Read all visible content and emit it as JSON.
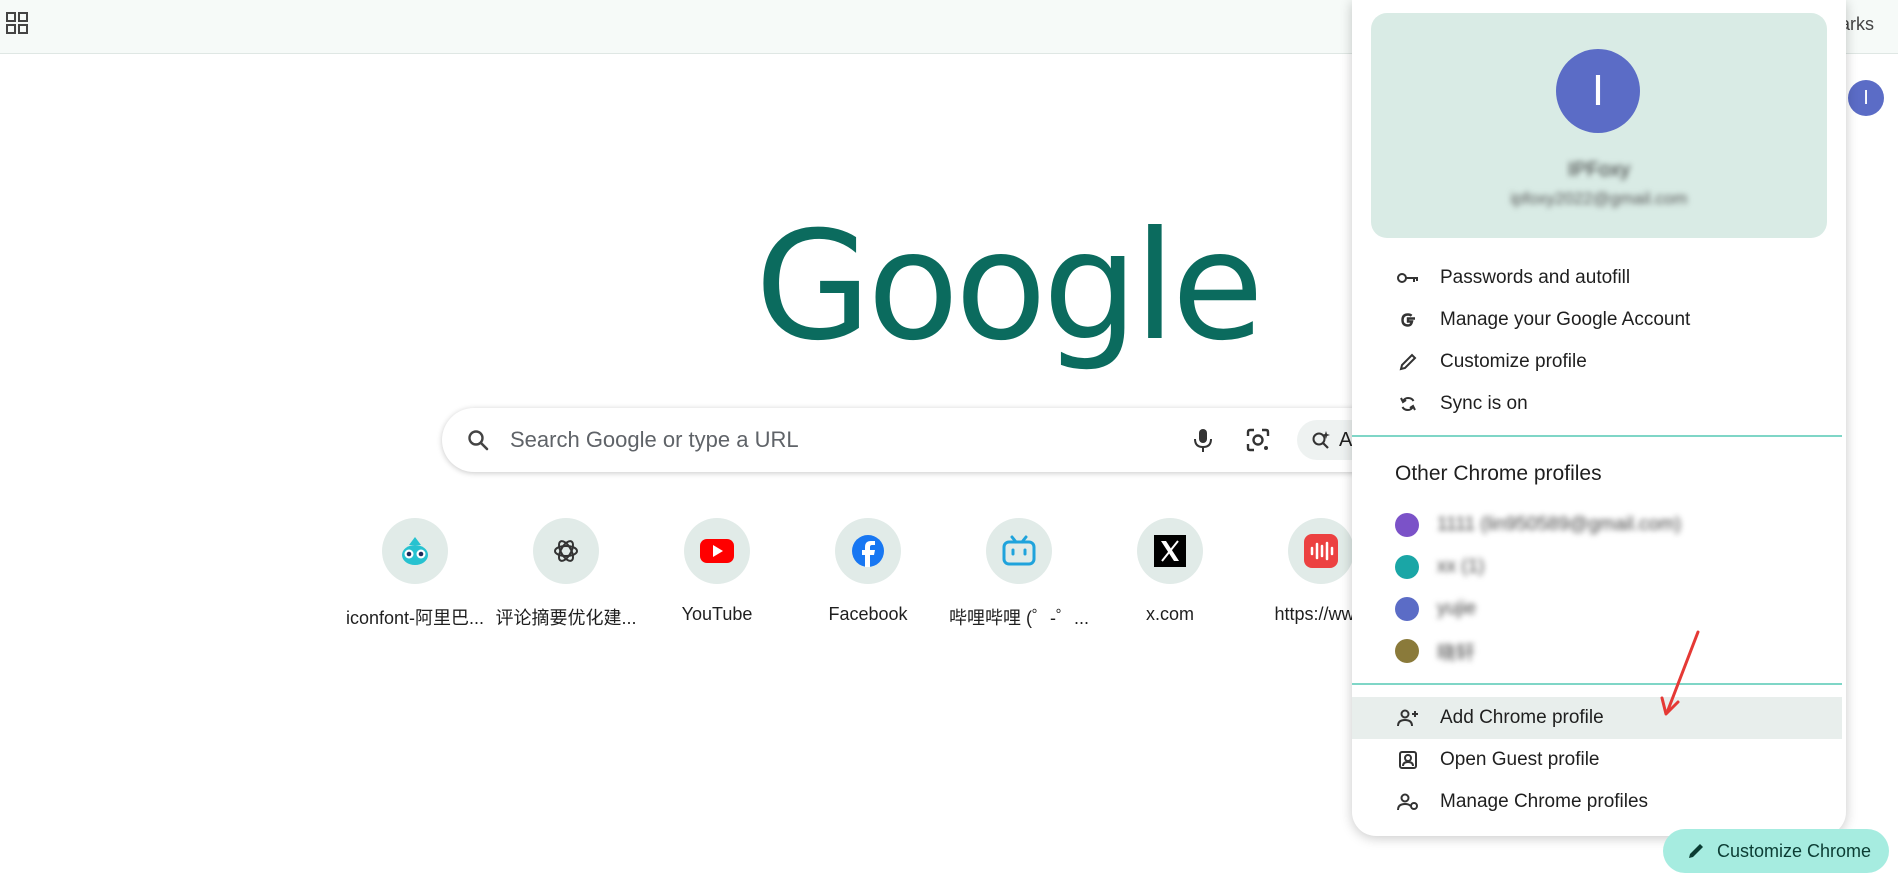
{
  "topbar": {
    "bookmarks_label": "arks"
  },
  "corner_avatar_letter": "I",
  "logo": "Google",
  "search": {
    "placeholder": "Search Google or type a URL",
    "ai_chip_letter": "A"
  },
  "shortcuts": [
    {
      "label": "iconfont-阿里巴...",
      "icon": "iconfont-mascot-icon"
    },
    {
      "label": "评论摘要优化建...",
      "icon": "chatgpt-icon"
    },
    {
      "label": "YouTube",
      "icon": "youtube-icon"
    },
    {
      "label": "Facebook",
      "icon": "facebook-icon"
    },
    {
      "label": "哔哩哔哩 (゜-゜...",
      "icon": "bilibili-icon"
    },
    {
      "label": "x.com",
      "icon": "x-icon"
    },
    {
      "label": "https://www",
      "icon": "netease-music-icon"
    }
  ],
  "profile_menu": {
    "avatar_letter": "I",
    "name": "IPFoxy",
    "email": "ipfoxy2022@gmail.com",
    "items": [
      {
        "label": "Passwords and autofill",
        "icon": "key-icon"
      },
      {
        "label": "Manage your Google Account",
        "icon": "google-g-icon"
      },
      {
        "label": "Customize profile",
        "icon": "pencil-icon"
      },
      {
        "label": "Sync is on",
        "icon": "sync-icon"
      }
    ],
    "other_profiles_title": "Other Chrome profiles",
    "other_profiles": [
      {
        "name": "1111 (lin950589@gmail.com)",
        "color": "#7b52c8"
      },
      {
        "name": "xx (1)",
        "color": "#1aa6a6"
      },
      {
        "name": "yujie",
        "color": "#5b6cc6"
      },
      {
        "name": "晓轩",
        "color": "#8a7a3a"
      }
    ],
    "bottom_items": [
      {
        "label": "Add Chrome profile",
        "icon": "add-person-icon"
      },
      {
        "label": "Open Guest profile",
        "icon": "guest-profile-icon"
      },
      {
        "label": "Manage Chrome profiles",
        "icon": "manage-profiles-icon"
      }
    ]
  },
  "customize_chrome_label": "Customize Chrome",
  "colors": {
    "accent": "#0b6b5e",
    "avatar": "#5b6cc6",
    "profile_card": "#d9ebe5",
    "customize_button": "#a6ece0",
    "annotation_arrow": "#e53935"
  }
}
